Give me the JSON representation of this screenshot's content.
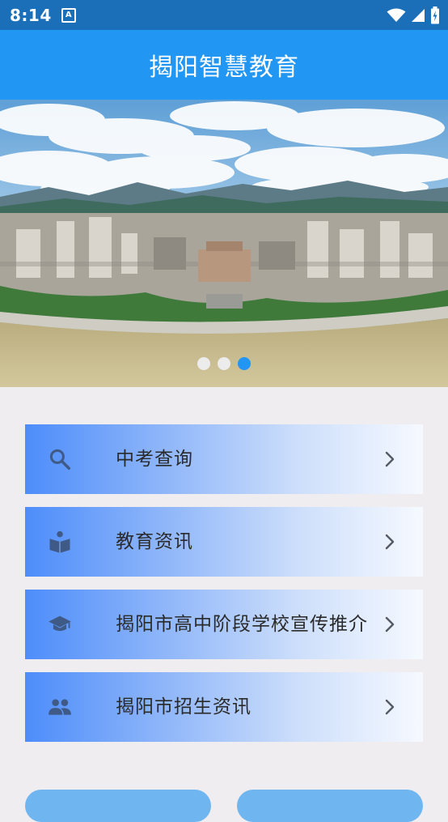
{
  "status_bar": {
    "time": "8:14",
    "a_badge": "A",
    "icons": [
      "wifi-icon",
      "cell-signal-icon",
      "battery-charging-icon"
    ]
  },
  "app_bar": {
    "title": "揭阳智慧教育"
  },
  "carousel": {
    "page_count": 3,
    "active_page": 3
  },
  "menu": {
    "items": [
      {
        "label": "中考查询",
        "icon": "search-icon"
      },
      {
        "label": "教育资讯",
        "icon": "book-reader-icon"
      },
      {
        "label": "揭阳市高中阶段学校宣传推介",
        "icon": "graduation-cap-icon"
      },
      {
        "label": "揭阳市招生资讯",
        "icon": "people-icon"
      }
    ]
  },
  "colors": {
    "status_bar": "#1B6FB8",
    "app_bar": "#2196F3",
    "page_bg": "#EFEDF0",
    "menu_gradient_start": "#4D8DFA",
    "menu_gradient_end": "#F6F9FF",
    "icon_color": "#3F5A86",
    "dot_active": "#2196F3",
    "dot_inactive": "#ECECEC",
    "bottom_button": "#6FB6F1"
  }
}
